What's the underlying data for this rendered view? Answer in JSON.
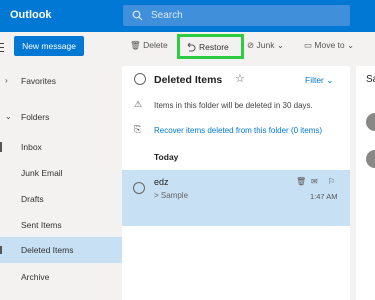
{
  "header": {
    "app_title": "Outlook",
    "search_placeholder": "Search"
  },
  "left_nav": {
    "new_message": "New message",
    "items": [
      {
        "label": "Favorites"
      },
      {
        "label": "Folders"
      },
      {
        "label": "Inbox"
      },
      {
        "label": "Junk Email"
      },
      {
        "label": "Drafts"
      },
      {
        "label": "Sent Items"
      },
      {
        "label": "Deleted Items"
      },
      {
        "label": "Archive"
      }
    ]
  },
  "toolbar": {
    "delete": "Delete",
    "restore": "Restore",
    "junk": "Junk",
    "move_to": "Move to"
  },
  "list": {
    "folder_title": "Deleted Items",
    "filter": "Filter",
    "notice": "Items in this folder will be deleted in 30 days.",
    "recover": "Recover items deleted from this folder (0 items)",
    "group": "Today",
    "message": {
      "from": "edz",
      "subject": "> Sample",
      "time": "1:47 AM"
    }
  },
  "reading_pane": {
    "title": "Sa"
  },
  "colors": {
    "brand": "#0078d4",
    "selected": "#c7e0f4",
    "highlight": "#2ecc40"
  }
}
